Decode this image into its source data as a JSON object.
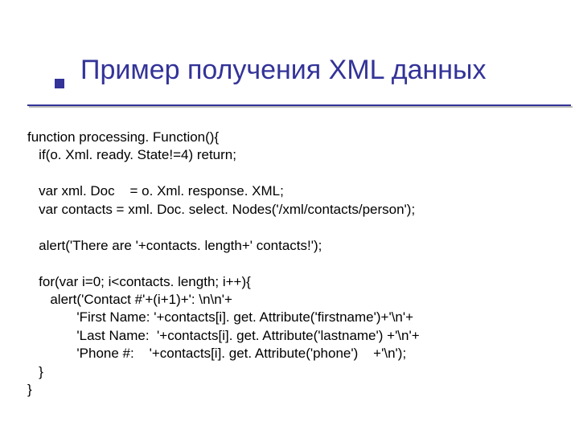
{
  "title": "Пример получения XML данных",
  "code": {
    "l1": "function processing. Function(){",
    "l2": "   if(o. Xml. ready. State!=4) return;",
    "l3": "",
    "l4": "   var xml. Doc    = o. Xml. response. XML;",
    "l5": "   var contacts = xml. Doc. select. Nodes('/xml/contacts/person');",
    "l6": "",
    "l7": "   alert('There are '+contacts. length+' contacts!');",
    "l8": "",
    "l9": "   for(var i=0; i<contacts. length; i++){",
    "l10": "      alert('Contact #'+(i+1)+': \\n\\n'+",
    "l11": "             'First Name: '+contacts[i]. get. Attribute('firstname')+'\\n'+",
    "l12": "             'Last Name:  '+contacts[i]. get. Attribute('lastname') +'\\n'+",
    "l13": "             'Phone #:    '+contacts[i]. get. Attribute('phone')    +'\\n');",
    "l14": "   }",
    "l15": "}"
  }
}
